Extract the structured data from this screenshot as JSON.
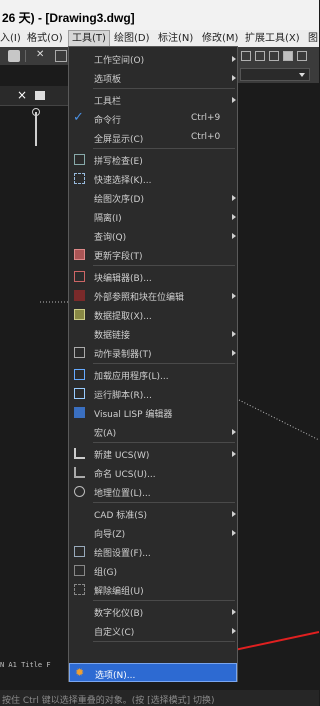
{
  "window": {
    "title": "26 天) - [Drawing3.dwg]"
  },
  "menubar": [
    {
      "label": "入(I)"
    },
    {
      "label": "格式(O)"
    },
    {
      "label": "工具(T)",
      "active": true
    },
    {
      "label": "绘图(D)"
    },
    {
      "label": "标注(N)"
    },
    {
      "label": "修改(M)"
    },
    {
      "label": "扩展工具(X)"
    },
    {
      "label": "图"
    }
  ],
  "file_tab": {
    "close": "×"
  },
  "tools_menu": {
    "items": [
      {
        "label": "工作空间(O)",
        "submenu": true
      },
      {
        "label": "选项板",
        "submenu": true
      },
      {
        "label": "工具栏",
        "submenu": true
      },
      {
        "label": "命令行",
        "shortcut": "Ctrl+9",
        "checked": true
      },
      {
        "label": "全屏显示(C)",
        "shortcut": "Ctrl+0"
      },
      {
        "label": "拼写检查(E)"
      },
      {
        "label": "快速选择(K)..."
      },
      {
        "label": "绘图次序(D)",
        "submenu": true
      },
      {
        "label": "隔离(I)",
        "submenu": true
      },
      {
        "label": "查询(Q)",
        "submenu": true
      },
      {
        "label": "更新字段(T)"
      },
      {
        "label": "块编辑器(B)..."
      },
      {
        "label": "外部参照和块在位编辑",
        "submenu": true
      },
      {
        "label": "数据提取(X)..."
      },
      {
        "label": "数据链接",
        "submenu": true
      },
      {
        "label": "动作录制器(T)",
        "submenu": true
      },
      {
        "label": "加载应用程序(L)..."
      },
      {
        "label": "运行脚本(R)..."
      },
      {
        "label": "Visual LISP 编辑器"
      },
      {
        "label": "宏(A)",
        "submenu": true
      },
      {
        "label": "新建 UCS(W)",
        "submenu": true
      },
      {
        "label": "命名 UCS(U)..."
      },
      {
        "label": "地理位置(L)..."
      },
      {
        "label": "CAD 标准(S)",
        "submenu": true
      },
      {
        "label": "向导(Z)",
        "submenu": true
      },
      {
        "label": "绘图设置(F)..."
      },
      {
        "label": "组(G)"
      },
      {
        "label": "解除编组(U)"
      },
      {
        "label": "数字化仪(B)",
        "submenu": true
      },
      {
        "label": "自定义(C)",
        "submenu": true
      },
      {
        "label": "选项(N)...",
        "highlighted": true
      }
    ]
  },
  "commandline": {
    "text": "N A1 Title F"
  },
  "statusbar": {
    "text": "按住 Ctrl 键以选择重叠的对象。(按 [选择模式] 切换)"
  },
  "colors": {
    "menu_bg": "#2b2b2b",
    "highlight": "#2d6ad2",
    "check": "#4a90e2",
    "annotation_arrow": "#e02020"
  }
}
